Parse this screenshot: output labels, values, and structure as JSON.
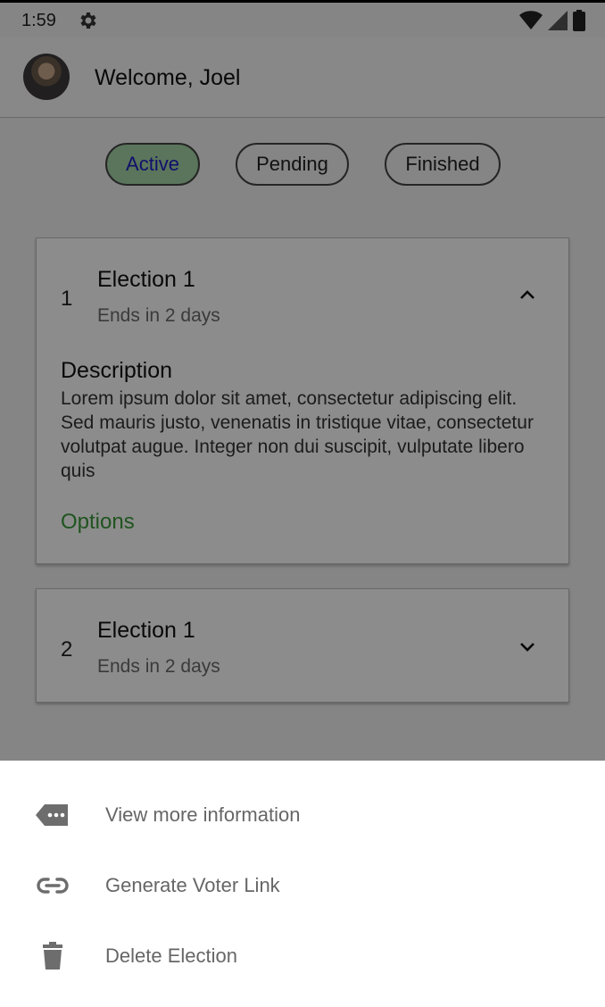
{
  "status_bar": {
    "time": "1:59"
  },
  "header": {
    "welcome": "Welcome, Joel"
  },
  "tabs": [
    {
      "label": "Active",
      "selected": true
    },
    {
      "label": "Pending",
      "selected": false
    },
    {
      "label": "Finished",
      "selected": false
    }
  ],
  "elections": [
    {
      "index": "1",
      "title": "Election 1",
      "subtitle": "Ends in 2 days",
      "expanded": true,
      "description_title": "Description",
      "description": "Lorem ipsum dolor sit amet, consectetur adipiscing elit. Sed mauris justo, venenatis in tristique vitae, consectetur volutpat augue. Integer non dui suscipit, vulputate libero quis",
      "options_label": "Options"
    },
    {
      "index": "2",
      "title": "Election 1",
      "subtitle": "Ends in 2 days",
      "expanded": false
    }
  ],
  "sheet": {
    "items": [
      {
        "label": "View more information",
        "icon": "more-tag-icon"
      },
      {
        "label": "Generate Voter Link",
        "icon": "link-icon"
      },
      {
        "label": "Delete Election",
        "icon": "trash-icon"
      }
    ]
  },
  "colors": {
    "accent_green": "#a5d6a7",
    "selected_text": "#1f1cc4",
    "options_green": "#3a9a3a",
    "scrim": "rgba(0,0,0,0.45)"
  }
}
